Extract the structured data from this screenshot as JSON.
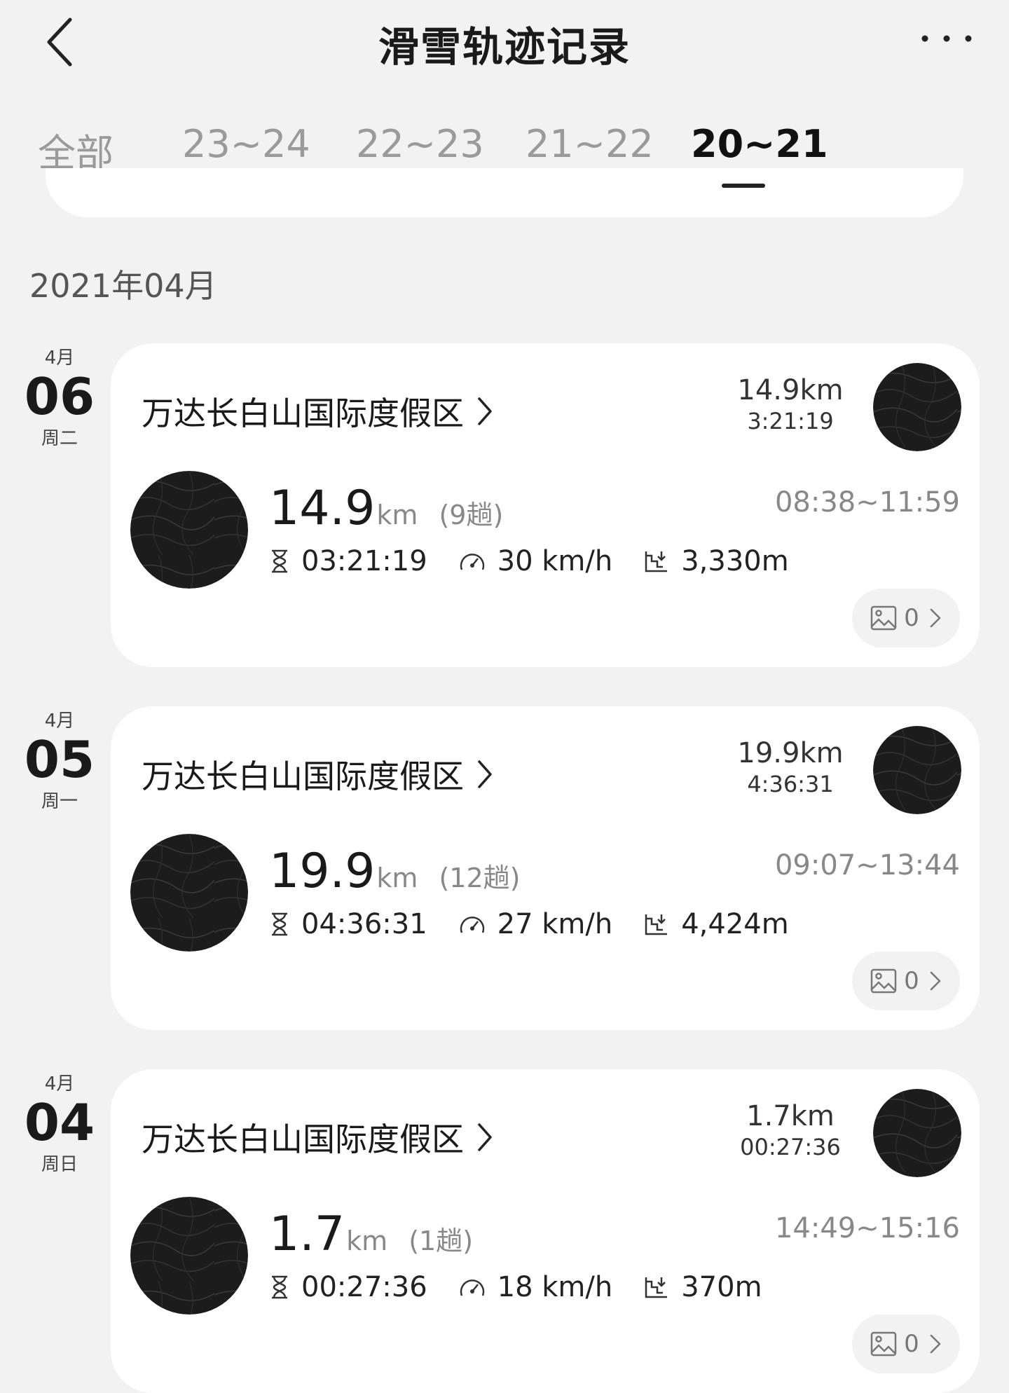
{
  "header": {
    "title": "滑雪轨迹记录"
  },
  "tabs": [
    {
      "label": "全部",
      "active": false
    },
    {
      "label": "23~24",
      "active": false
    },
    {
      "label": "22~23",
      "active": false
    },
    {
      "label": "21~22",
      "active": false
    },
    {
      "label": "20~21",
      "active": true
    }
  ],
  "month_label": "2021年04月",
  "records": [
    {
      "month": "4月",
      "day": "06",
      "weekday": "周二",
      "resort": "万达长白山国际度假区",
      "top_distance": "14.9km",
      "top_duration": "3:21:19",
      "distance": "14.9",
      "unit": "km",
      "runs": "(9趟)",
      "time_range": "08:38~11:59",
      "duration": "03:21:19",
      "speed": "30 km/h",
      "descent": "3,330m",
      "photos": "0"
    },
    {
      "month": "4月",
      "day": "05",
      "weekday": "周一",
      "resort": "万达长白山国际度假区",
      "top_distance": "19.9km",
      "top_duration": "4:36:31",
      "distance": "19.9",
      "unit": "km",
      "runs": "(12趟)",
      "time_range": "09:07~13:44",
      "duration": "04:36:31",
      "speed": "27 km/h",
      "descent": "4,424m",
      "photos": "0"
    },
    {
      "month": "4月",
      "day": "04",
      "weekday": "周日",
      "resort": "万达长白山国际度假区",
      "top_distance": "1.7km",
      "top_duration": "00:27:36",
      "distance": "1.7",
      "unit": "km",
      "runs": "(1趟)",
      "time_range": "14:49~15:16",
      "duration": "00:27:36",
      "speed": "18 km/h",
      "descent": "370m",
      "photos": "0"
    }
  ],
  "icons": [
    "back-arrow-icon",
    "more-dots-icon",
    "chevron-right-icon",
    "hourglass-icon",
    "speedometer-icon",
    "descent-icon",
    "image-icon"
  ]
}
